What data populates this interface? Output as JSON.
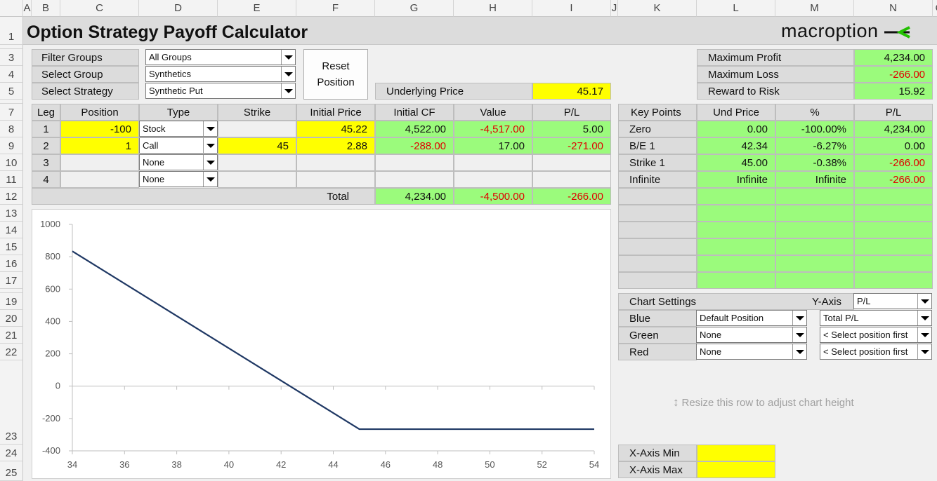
{
  "columns": [
    "A",
    "B",
    "C",
    "D",
    "E",
    "F",
    "G",
    "H",
    "I",
    "J",
    "K",
    "L",
    "M",
    "N",
    "O"
  ],
  "rows": [
    "1",
    "3",
    "4",
    "5",
    "7",
    "8",
    "9",
    "10",
    "11",
    "12",
    "13",
    "14",
    "15",
    "16",
    "17",
    "19",
    "20",
    "21",
    "22",
    "23",
    "24",
    "25"
  ],
  "title": "Option Strategy Payoff Calculator",
  "brand": "macroption",
  "filters": {
    "filter_groups_label": "Filter Groups",
    "filter_groups_value": "All Groups",
    "select_group_label": "Select Group",
    "select_group_value": "Synthetics",
    "select_strategy_label": "Select Strategy",
    "select_strategy_value": "Synthetic Put",
    "reset_label": "Reset Position"
  },
  "underlying": {
    "label": "Underlying Price",
    "value": "45.17"
  },
  "summary": {
    "max_profit_label": "Maximum Profit",
    "max_profit": "4,234.00",
    "max_loss_label": "Maximum Loss",
    "max_loss": "-266.00",
    "reward_risk_label": "Reward to Risk",
    "reward_risk": "15.92"
  },
  "legs": {
    "headers": [
      "Leg",
      "Position",
      "Type",
      "Strike",
      "Initial Price",
      "Initial CF",
      "Value",
      "P/L"
    ],
    "rows": [
      {
        "leg": "1",
        "position": "-100",
        "type": "Stock",
        "strike": "",
        "price": "45.22",
        "cf": "4,522.00",
        "value": "-4,517.00",
        "pl": "5.00"
      },
      {
        "leg": "2",
        "position": "1",
        "type": "Call",
        "strike": "45",
        "price": "2.88",
        "cf": "-288.00",
        "value": "17.00",
        "pl": "-271.00"
      },
      {
        "leg": "3",
        "position": "",
        "type": "None",
        "strike": "",
        "price": "",
        "cf": "",
        "value": "",
        "pl": ""
      },
      {
        "leg": "4",
        "position": "",
        "type": "None",
        "strike": "",
        "price": "",
        "cf": "",
        "value": "",
        "pl": ""
      }
    ],
    "total_label": "Total",
    "total_cf": "4,234.00",
    "total_value": "-4,500.00",
    "total_pl": "-266.00"
  },
  "key_points": {
    "headers": [
      "Key Points",
      "Und Price",
      "%",
      "P/L"
    ],
    "rows": [
      {
        "name": "Zero",
        "price": "0.00",
        "pct": "-100.00%",
        "pl": "4,234.00"
      },
      {
        "name": "B/E 1",
        "price": "42.34",
        "pct": "-6.27%",
        "pl": "0.00"
      },
      {
        "name": "Strike 1",
        "price": "45.00",
        "pct": "-0.38%",
        "pl": "-266.00"
      },
      {
        "name": "Infinite",
        "price": "Infinite",
        "pct": "Infinite",
        "pl": "-266.00"
      }
    ]
  },
  "chart_settings": {
    "label": "Chart Settings",
    "yaxis_label": "Y-Axis",
    "yaxis_value": "P/L",
    "blue_label": "Blue",
    "blue_position": "Default Position",
    "blue_series": "Total P/L",
    "green_label": "Green",
    "green_position": "None",
    "green_series": "< Select position first",
    "red_label": "Red",
    "red_position": "None",
    "red_series": "< Select position first",
    "resize_hint": "Resize this row to adjust chart height",
    "xmin_label": "X-Axis Min",
    "xmax_label": "X-Axis Max"
  },
  "colors": {
    "line": "#1f3864",
    "green": "#9bfb7c",
    "yellow": "#ffff00",
    "red": "#e00000"
  },
  "chart_data": {
    "type": "line",
    "title": "",
    "xlabel": "",
    "ylabel": "",
    "xlim": [
      34,
      54
    ],
    "ylim": [
      -400,
      1000
    ],
    "xticks": [
      34,
      36,
      38,
      40,
      42,
      44,
      46,
      48,
      50,
      52,
      54
    ],
    "yticks": [
      1000,
      800,
      600,
      400,
      200,
      0,
      -200,
      -400
    ],
    "series": [
      {
        "color": "#1f3864",
        "x": [
          34,
          45,
          54
        ],
        "y": [
          834,
          -266,
          -266
        ]
      }
    ]
  }
}
